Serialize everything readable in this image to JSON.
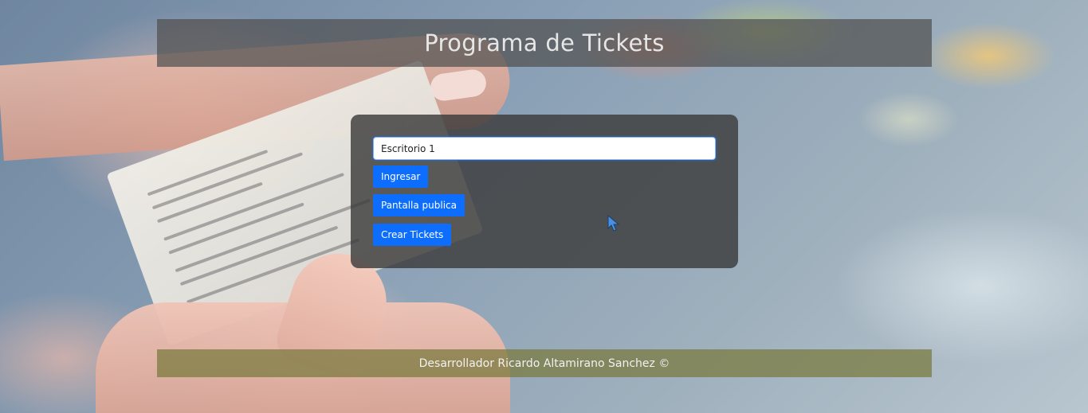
{
  "header": {
    "title": "Programa de Tickets"
  },
  "form": {
    "desk_input_value": "Escritorio 1",
    "ingresar_label": "Ingresar",
    "pantalla_label": "Pantalla publica",
    "crear_label": "Crear Tickets"
  },
  "footer": {
    "text": "Desarrollador Ricardo Altamirano Sanchez ©"
  },
  "colors": {
    "button": "#0d6efd",
    "header_bg": "#505050",
    "footer_bg": "#78783c"
  },
  "icons": {
    "cursor": "mouse-pointer-icon"
  }
}
